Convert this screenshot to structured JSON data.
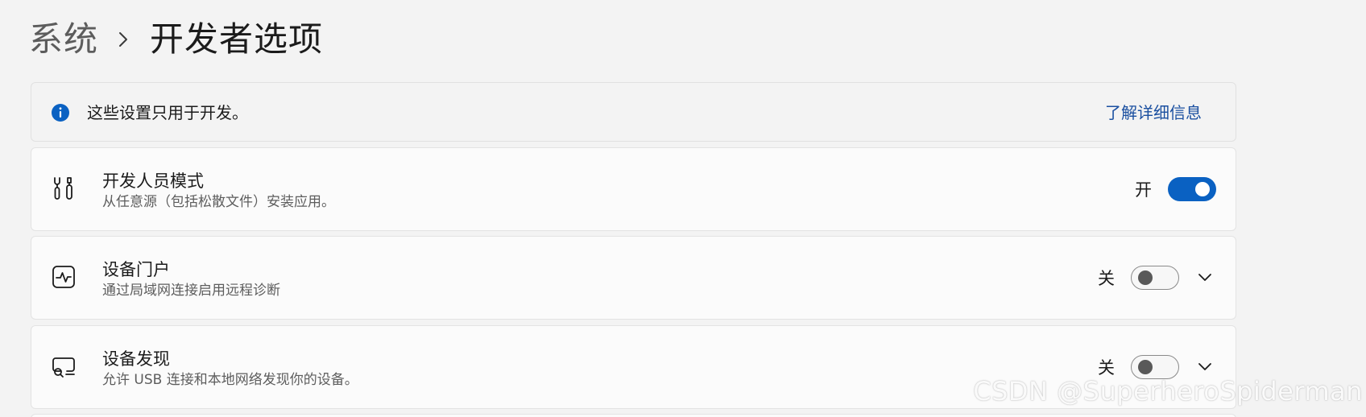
{
  "breadcrumb": {
    "parent": "系统",
    "current": "开发者选项"
  },
  "info": {
    "icon": "info-icon",
    "text": "这些设置只用于开发。",
    "link": "了解详细信息"
  },
  "settings": [
    {
      "icon": "tools-icon",
      "title": "开发人员模式",
      "description": "从任意源（包括松散文件）安装应用。",
      "state_label": "开",
      "on": true,
      "expandable": false
    },
    {
      "icon": "activity-icon",
      "title": "设备门户",
      "description": "通过局域网连接启用远程诊断",
      "state_label": "关",
      "on": false,
      "expandable": true
    },
    {
      "icon": "device-search-icon",
      "title": "设备发现",
      "description": "允许 USB 连接和本地网络发现你的设备。",
      "state_label": "关",
      "on": false,
      "expandable": true
    }
  ],
  "watermark": "CSDN @SuperheroSpiderman",
  "colors": {
    "accent": "#0a61c2",
    "link": "#1a4fa0",
    "background": "#f3f3f3"
  }
}
